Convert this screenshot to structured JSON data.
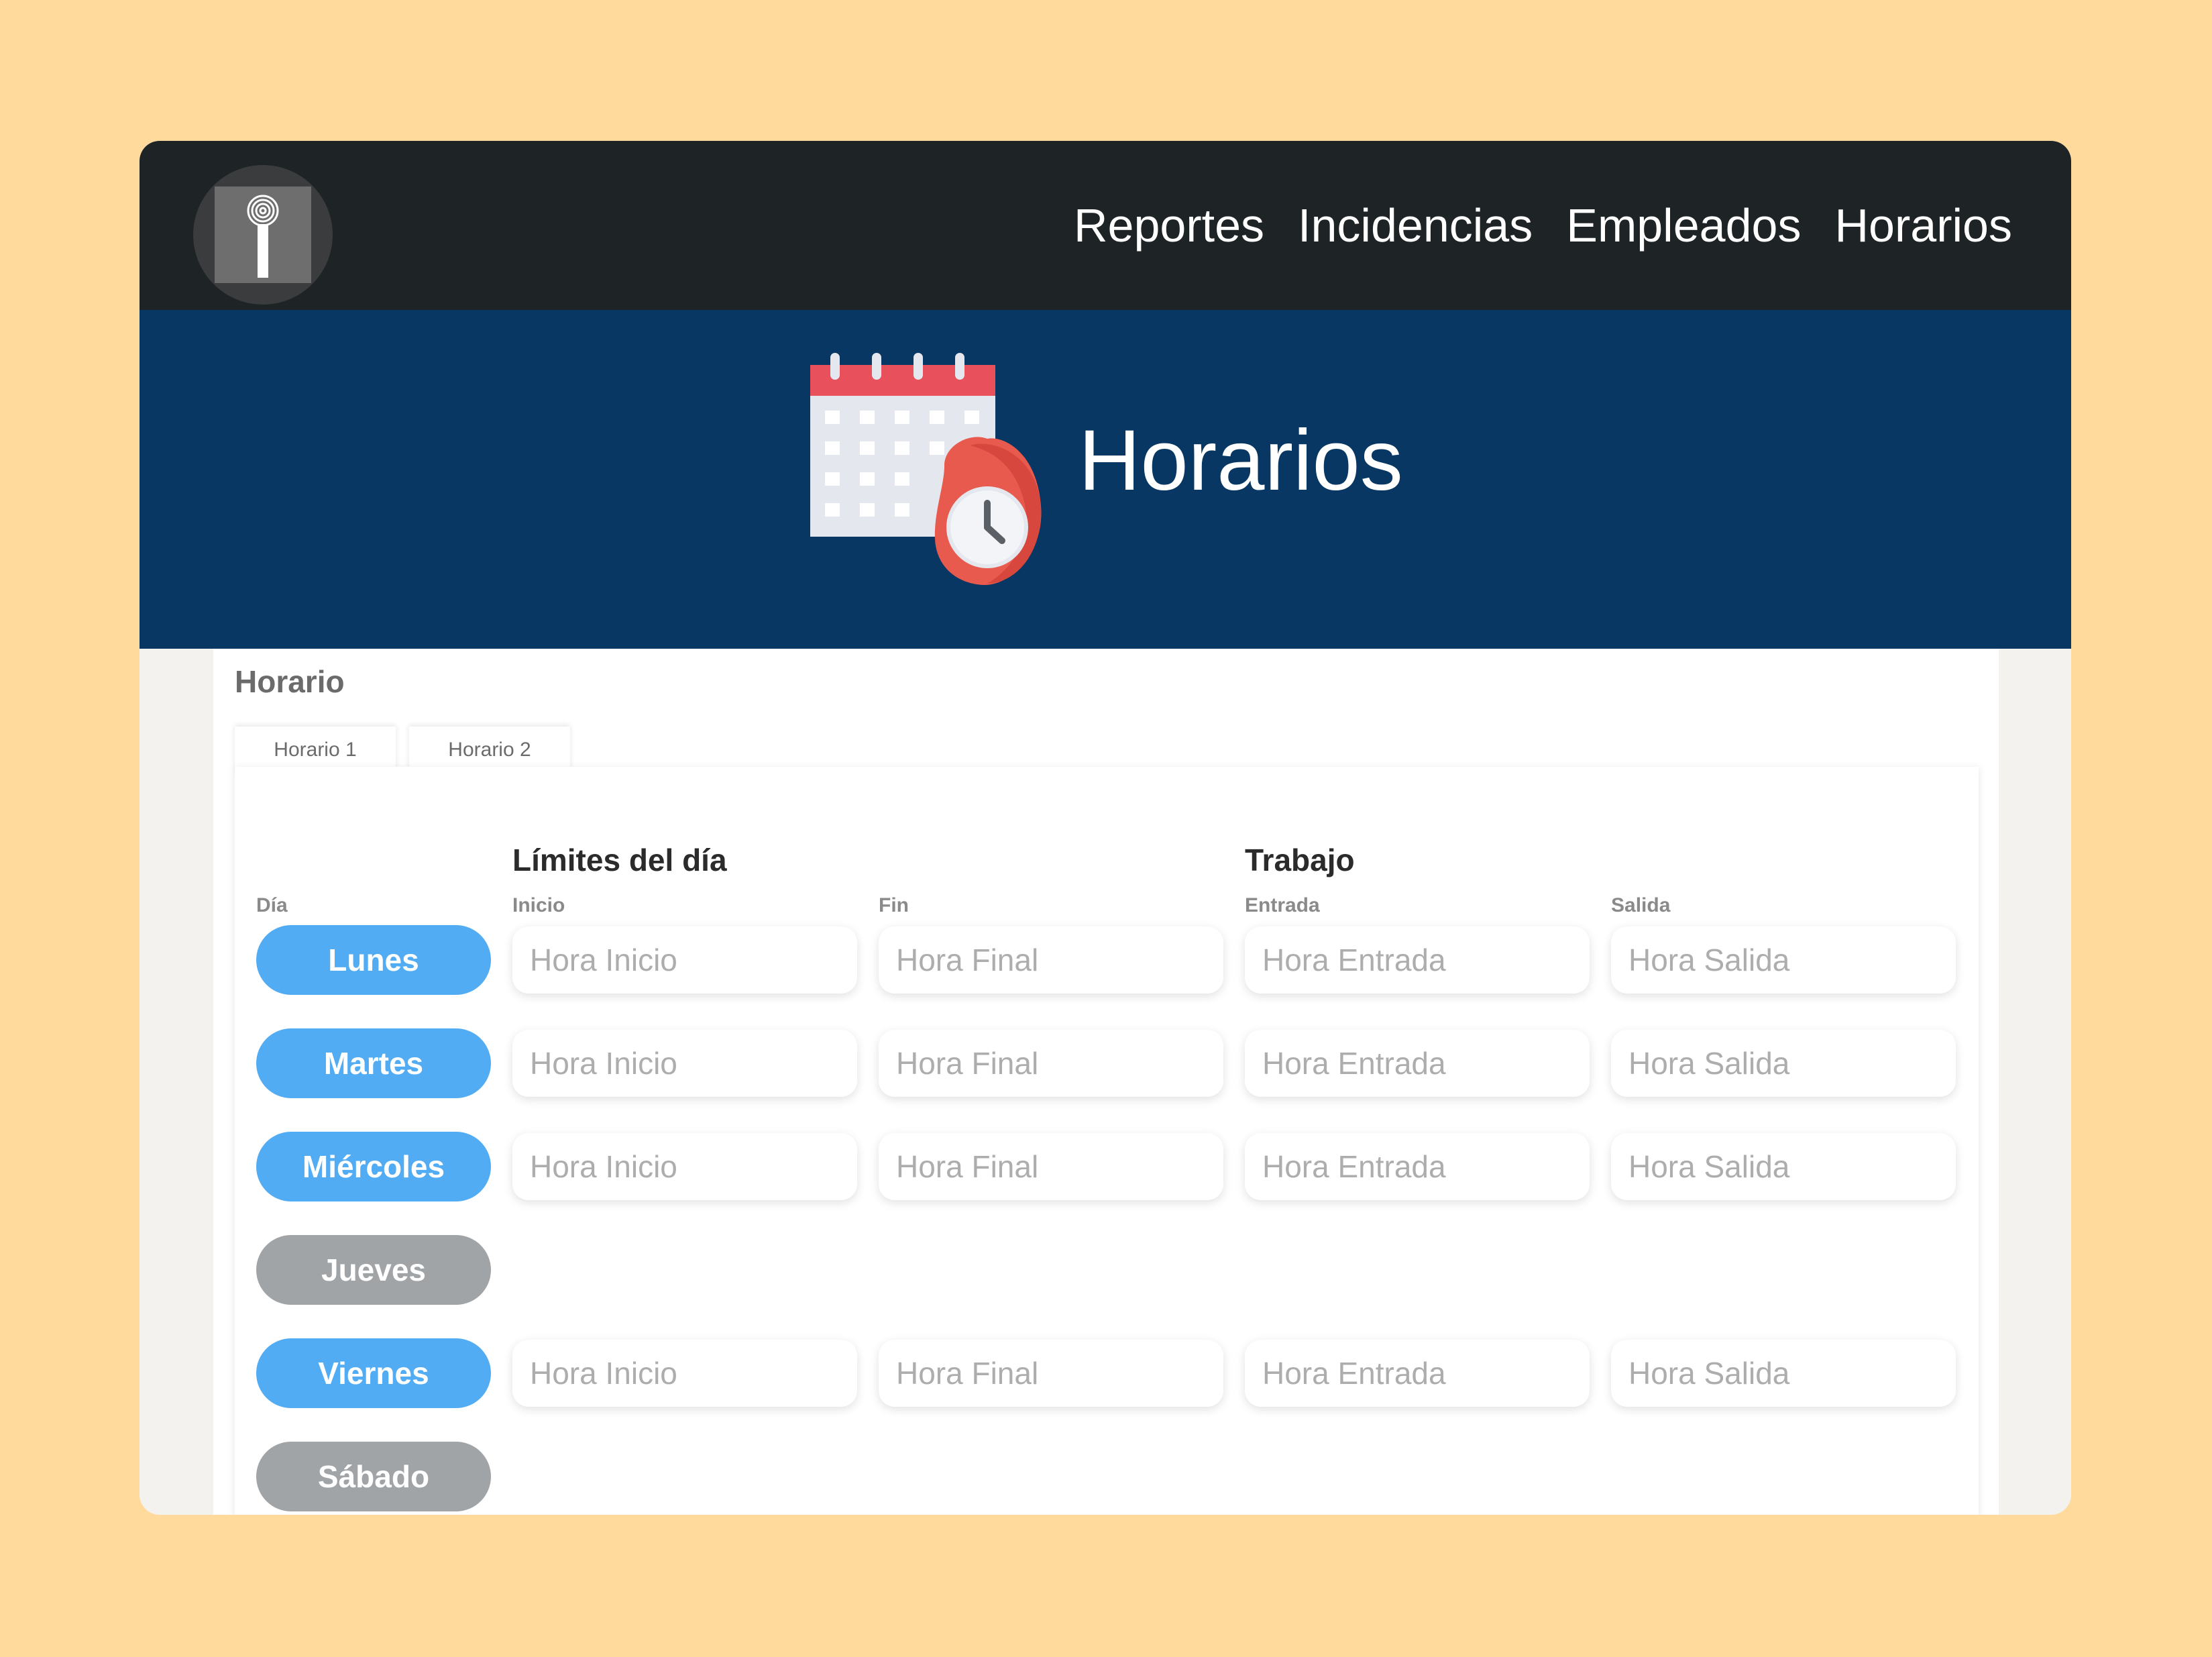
{
  "nav": {
    "links": [
      "Reportes",
      "Incidencias",
      "Empleados",
      "Horarios"
    ]
  },
  "hero": {
    "title": "Horarios"
  },
  "card": {
    "title": "Horario",
    "tabs": [
      "Horario 1",
      "Horario 2"
    ]
  },
  "table": {
    "section_limits": "Límites del día",
    "section_work": "Trabajo",
    "col_day": "Día",
    "col_start": "Inicio",
    "col_end": "Fin",
    "col_entry": "Entrada",
    "col_exit": "Salida",
    "placeholders": {
      "start": "Hora Inicio",
      "end": "Hora Final",
      "entry": "Hora Entrada",
      "exit": "Hora Salida"
    },
    "days": [
      {
        "label": "Lunes",
        "active": true
      },
      {
        "label": "Martes",
        "active": true
      },
      {
        "label": "Miércoles",
        "active": true
      },
      {
        "label": "Jueves",
        "active": false
      },
      {
        "label": "Viernes",
        "active": true
      },
      {
        "label": "Sábado",
        "active": false
      }
    ]
  },
  "colors": {
    "page_bg": "#FFDA9C",
    "navbar": "#1E2326",
    "hero": "#073762",
    "day_active": "#52ACF4",
    "day_inactive": "#A1A4A7"
  }
}
